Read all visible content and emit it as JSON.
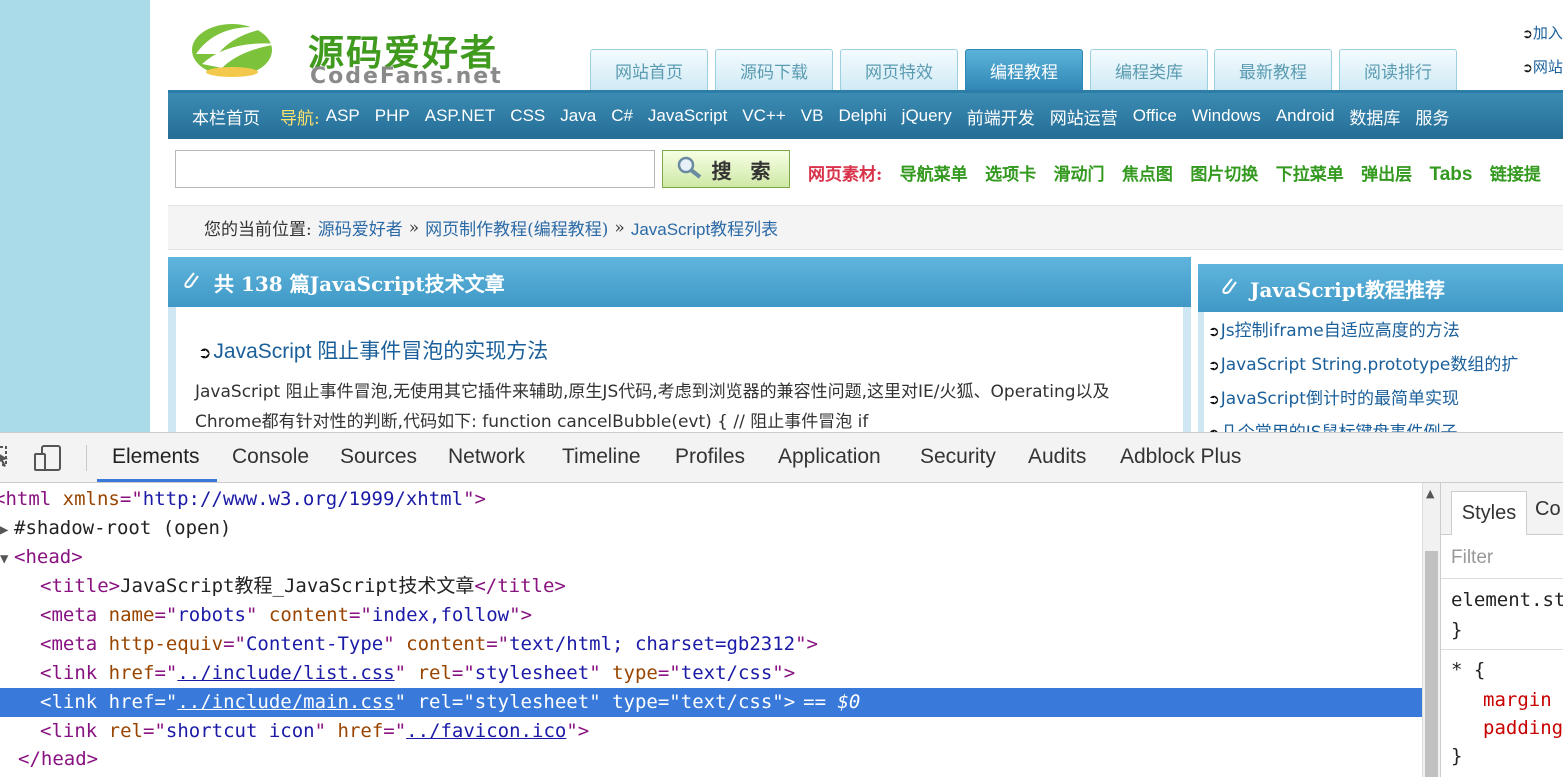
{
  "site": {
    "logo": {
      "name": "源码爱好者",
      "domain": "CodeFans.net"
    },
    "tabs": [
      "网站首页",
      "源码下载",
      "网页特效",
      "编程教程",
      "编程类库",
      "最新教程",
      "阅读排行"
    ],
    "active_tab": "编程教程",
    "top_right": [
      "加入",
      "网站"
    ],
    "nav": {
      "home": "本栏首页",
      "label": "导航:",
      "items": [
        "ASP",
        "PHP",
        "ASP.NET",
        "CSS",
        "Java",
        "C#",
        "JavaScript",
        "VC++",
        "VB",
        "Delphi",
        "jQuery",
        "前端开发",
        "网站运营",
        "Office",
        "Windows",
        "Android",
        "数据库",
        "服务"
      ]
    },
    "search": {
      "value": "",
      "button": "搜 索"
    },
    "materials": {
      "label": "网页素材:",
      "items": [
        "导航菜单",
        "选项卡",
        "滑动门",
        "焦点图",
        "图片切换",
        "下拉菜单",
        "弹出层"
      ],
      "tabs": "Tabs",
      "more": "链接提"
    },
    "breadcrumb": {
      "label": "您的当前位置:",
      "items": [
        "源码爱好者",
        "网页制作教程(编程教程)",
        "JavaScript教程列表"
      ],
      "sep": "»"
    },
    "main_panel": {
      "title": "共 138 篇JavaScript技术文章",
      "article_title": "JavaScript 阻止事件冒泡的实现方法",
      "article_desc": "JavaScript 阻止事件冒泡,无使用其它插件来辅助,原生JS代码,考虑到浏览器的兼容性问题,这里对IE/火狐、Operating以及Chrome都有针对性的判断,代码如下: function cancelBubble(evt) { // 阻止事件冒泡 if"
    },
    "side_panel": {
      "title": "JavaScript教程推荐",
      "items": [
        "Js控制iframe自适应高度的方法",
        "JavaScript String.prototype数组的扩",
        "JavaScript倒计时的最简单实现",
        "几个常用的JS鼠标键盘事件例子"
      ]
    }
  },
  "devtools": {
    "tabs": [
      "Elements",
      "Console",
      "Sources",
      "Network",
      "Timeline",
      "Profiles",
      "Application",
      "Security",
      "Audits",
      "Adblock Plus"
    ],
    "active_tab": "Elements",
    "dom": {
      "html_open": {
        "tag": "html",
        "attr": "xmlns",
        "value": "http://www.w3.org/1999/xhtml"
      },
      "shadow_root": "#shadow-root (open)",
      "head_tag": "head",
      "title_tag": "title",
      "title_text": "JavaScript教程_JavaScript技术文章",
      "meta1": {
        "tag": "meta",
        "a1": "name",
        "v1": "robots",
        "a2": "content",
        "v2": "index,follow"
      },
      "meta2": {
        "tag": "meta",
        "a1": "http-equiv",
        "v1": "Content-Type",
        "a2": "content",
        "v2": "text/html; charset=gb2312"
      },
      "link1": {
        "tag": "link",
        "a1": "href",
        "v1": "../include/list.css",
        "a2": "rel",
        "v2": "stylesheet",
        "a3": "type",
        "v3": "text/css"
      },
      "link2": {
        "tag": "link",
        "a1": "href",
        "v1": "../include/main.css",
        "a2": "rel",
        "v2": "stylesheet",
        "a3": "type",
        "v3": "text/css",
        "marker": "== $0"
      },
      "link3": {
        "tag": "link",
        "a1": "rel",
        "v1": "shortcut icon",
        "a2": "href",
        "v2": "../favicon.ico"
      },
      "head_close": "head"
    },
    "styles": {
      "tab": "Styles",
      "other_tab": "Co",
      "filter_placeholder": "Filter",
      "rule1_selector": "element.st",
      "rule1_close": "}",
      "rule2_selector": "* {",
      "rule2_prop1": "margin",
      "rule2_prop2": "padding",
      "rule2_close": "}"
    }
  }
}
